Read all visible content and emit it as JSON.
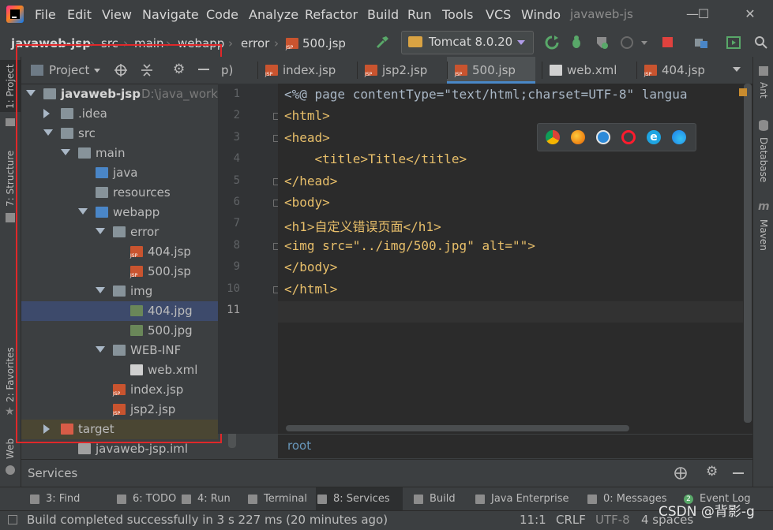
{
  "menubar": {
    "items": [
      "File",
      "Edit",
      "View",
      "Navigate",
      "Code",
      "Analyze",
      "Refactor",
      "Build",
      "Run",
      "Tools",
      "VCS",
      "Windo"
    ],
    "window_title": "javaweb-js"
  },
  "toolbar": {
    "breadcrumb": [
      "javaweb-jsp",
      "src",
      "main",
      "webapp",
      "error",
      "500.jsp"
    ],
    "run_config": "Tomcat 8.0.20"
  },
  "left_strip": {
    "project": "1: Project",
    "structure": "7: Structure",
    "favorites": "2: Favorites",
    "web": "Web"
  },
  "right_strip": {
    "ant": "Ant",
    "database": "Database",
    "maven": "Maven"
  },
  "project_panel": {
    "title": "Project",
    "root_name": "javaweb-jsp",
    "root_path": "D:\\java_workp",
    "tree": [
      {
        "label": "javaweb-jsp",
        "indent": 0,
        "arrow": "down",
        "icon": "folder"
      },
      {
        "label": ".idea",
        "indent": 1,
        "arrow": "right",
        "icon": "folder"
      },
      {
        "label": "src",
        "indent": 1,
        "arrow": "down",
        "icon": "folder"
      },
      {
        "label": "main",
        "indent": 2,
        "arrow": "down",
        "icon": "folder"
      },
      {
        "label": "java",
        "indent": 3,
        "arrow": "",
        "icon": "folder-blue"
      },
      {
        "label": "resources",
        "indent": 3,
        "arrow": "",
        "icon": "folder"
      },
      {
        "label": "webapp",
        "indent": 3,
        "arrow": "down",
        "icon": "folder-blue"
      },
      {
        "label": "error",
        "indent": 4,
        "arrow": "down",
        "icon": "folder"
      },
      {
        "label": "404.jsp",
        "indent": 5,
        "arrow": "",
        "icon": "jsp"
      },
      {
        "label": "500.jsp",
        "indent": 5,
        "arrow": "",
        "icon": "jsp"
      },
      {
        "label": "img",
        "indent": 4,
        "arrow": "down",
        "icon": "folder"
      },
      {
        "label": "404.jpg",
        "indent": 5,
        "arrow": "",
        "icon": "img",
        "selected": true
      },
      {
        "label": "500.jpg",
        "indent": 5,
        "arrow": "",
        "icon": "img"
      },
      {
        "label": "WEB-INF",
        "indent": 4,
        "arrow": "down",
        "icon": "folder"
      },
      {
        "label": "web.xml",
        "indent": 5,
        "arrow": "",
        "icon": "xml"
      },
      {
        "label": "index.jsp",
        "indent": 4,
        "arrow": "",
        "icon": "jsp"
      },
      {
        "label": "jsp2.jsp",
        "indent": 4,
        "arrow": "",
        "icon": "jsp"
      },
      {
        "label": "target",
        "indent": 1,
        "arrow": "right",
        "icon": "folder-red",
        "dim": true
      },
      {
        "label": "javaweb-jsp.iml",
        "indent": 2,
        "arrow": "",
        "icon": "iml"
      }
    ]
  },
  "editor": {
    "tabs": [
      {
        "label": "p)",
        "icon": "jsp",
        "active": false
      },
      {
        "label": "index.jsp",
        "icon": "jsp",
        "active": false
      },
      {
        "label": "jsp2.jsp",
        "icon": "jsp",
        "active": false
      },
      {
        "label": "500.jsp",
        "icon": "jsp",
        "active": true
      },
      {
        "label": "web.xml",
        "icon": "xml",
        "active": false
      },
      {
        "label": "404.jsp",
        "icon": "jsp",
        "active": false
      }
    ],
    "lines": [
      "<%@ page contentType=\"text/html;charset=UTF-8\" langua",
      "<html>",
      "<head>",
      "    <title>Title</title>",
      "</head>",
      "<body>",
      "<h1>自定义错误页面</h1>",
      "<img src=\"../img/500.jpg\" alt=\"\">",
      "</body>",
      "</html>",
      ""
    ],
    "current_line": 11,
    "breadcrumb": "root"
  },
  "services": {
    "title": "Services"
  },
  "bottom_tools": [
    {
      "label": "3: Find",
      "icon": "search-icon"
    },
    {
      "label": "6: TODO",
      "icon": "todo-icon"
    },
    {
      "label": "4: Run",
      "icon": "run-icon"
    },
    {
      "label": "Terminal",
      "icon": "terminal-icon"
    },
    {
      "label": "8: Services",
      "icon": "services-icon",
      "active": true
    },
    {
      "label": "Build",
      "icon": "build-icon"
    },
    {
      "label": "Java Enterprise",
      "icon": "java-enterprise-icon"
    },
    {
      "label": "0: Messages",
      "icon": "messages-icon"
    },
    {
      "label": "Event Log",
      "icon": "event-log-icon",
      "badge": "2"
    }
  ],
  "status": {
    "message": "Build completed successfully in 3 s 227 ms (20 minutes ago)",
    "position": "11:1",
    "line_sep": "CRLF",
    "encoding": "UTF-8",
    "indent": "4 spaces",
    "watermark": "CSDN @背影-g"
  }
}
